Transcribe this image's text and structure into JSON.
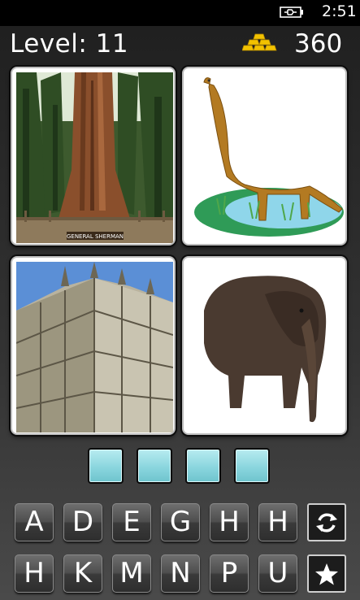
{
  "status": {
    "time": "2:51",
    "battery_icon": "battery-charging-icon"
  },
  "header": {
    "level_label": "Level:",
    "level": "11",
    "coins": "360",
    "coins_icon": "gold-bars-icon"
  },
  "images": [
    {
      "name": "sequoia-tree-photo",
      "caption": "GENERAL SHERMAN"
    },
    {
      "name": "brachiosaurus-clipart"
    },
    {
      "name": "gothic-cathedral-photo"
    },
    {
      "name": "elephant-photo"
    }
  ],
  "answer_slots": [
    "",
    "",
    "",
    ""
  ],
  "letters_row1": [
    "A",
    "D",
    "E",
    "G",
    "H",
    "H"
  ],
  "letters_row2": [
    "H",
    "K",
    "M",
    "N",
    "P",
    "U"
  ],
  "actions": {
    "shuffle_icon": "shuffle-icon",
    "hint_icon": "star-icon"
  },
  "colors": {
    "slot": "#8ad6de",
    "coin_gold": "#f2c200"
  }
}
